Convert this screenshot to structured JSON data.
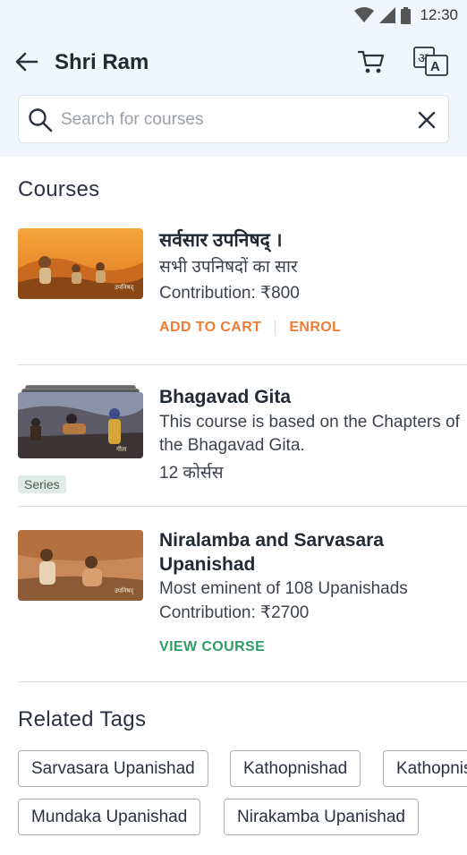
{
  "status_bar": {
    "time": "12:30"
  },
  "header": {
    "title": "Shri Ram"
  },
  "search": {
    "placeholder": "Search for courses",
    "value": ""
  },
  "courses_section": {
    "title": "Courses"
  },
  "courses": [
    {
      "title": "सर्वसार उपनिषद् ।",
      "subtitle": "सभी उपनिषदों का सार",
      "meta": "Contribution: ₹800",
      "actions": [
        "ADD TO CART",
        "ENROL"
      ]
    },
    {
      "title": "Bhagavad Gita",
      "subtitle": "This course is based on the Chapters of the Bhagavad Gita.",
      "meta": "12 कोर्सस",
      "badge": "Series"
    },
    {
      "title": "Niralamba and Sarvasara Upanishad",
      "subtitle": "Most eminent of 108 Upanishads",
      "meta": "Contribution: ₹2700",
      "actions": [
        "VIEW COURSE"
      ]
    }
  ],
  "related_tags": {
    "title": "Related Tags",
    "tags": [
      "Sarvasara Upanishad",
      "Kathopnishad",
      "Kathopnishad",
      "Mundaka Upanishad",
      "Nirakamba Upanishad"
    ]
  },
  "colors": {
    "accent_orange": "#f07b35",
    "accent_green": "#2f9e62",
    "header_bg": "#f1f6fc"
  },
  "icons": [
    "wifi-icon",
    "signal-icon",
    "battery-icon",
    "back-arrow-icon",
    "cart-icon",
    "translate-icon",
    "search-icon",
    "close-icon"
  ]
}
